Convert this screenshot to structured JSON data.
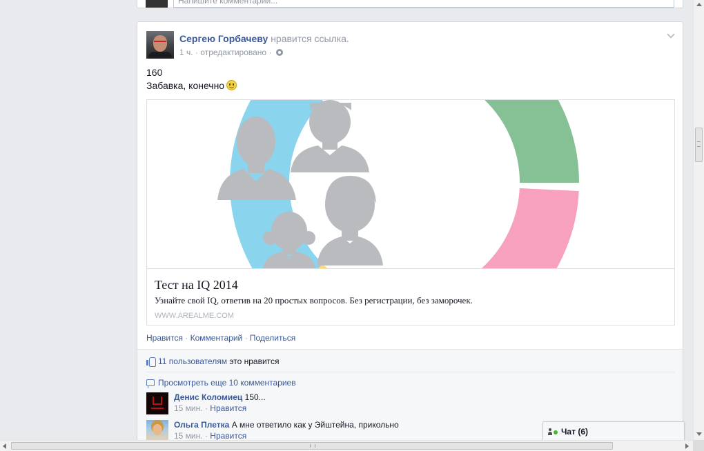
{
  "previous_post": {
    "comment_placeholder": "Напишите комментарий..."
  },
  "story": {
    "actor": "Сергею Горбачеву",
    "action": "нравится ссылка.",
    "time": "1 ч.",
    "edited": "отредактировано",
    "message_line1": "160",
    "message_line2": "Забавка, конечно",
    "attachment": {
      "title": "Тест на IQ 2014",
      "description": "Узнайте свой IQ, ответив на 20 простых вопросов. Без регистрации, без заморочек.",
      "domain": "WWW.AREALME.COM",
      "colors": {
        "blue": "#8ad4ee",
        "green": "#86c196",
        "pink": "#f7a1bf",
        "yellow": "#fed87a",
        "figures": "#b9bbbe"
      }
    },
    "actions": {
      "like": "Нравится",
      "comment": "Комментарий",
      "share": "Поделиться",
      "separator": "·"
    }
  },
  "ufi": {
    "likes_count": "11 пользователям",
    "likes_suffix": "это нравится",
    "view_more": "Просмотреть еще 10 комментариев",
    "comments": [
      {
        "author": "Денис Коломиец",
        "text": "150...",
        "time": "15 мин.",
        "like": "Нравится"
      },
      {
        "author": "Ольга Плетка",
        "text": "А мне ответило как у Эйштейна, прикольно",
        "time": "15 мин.",
        "like": "Нравится"
      }
    ]
  },
  "chat": {
    "label": "Чат (6)"
  },
  "colors": {
    "link": "#3b5998",
    "meta": "#9197a3",
    "background": "#e9eaed"
  }
}
